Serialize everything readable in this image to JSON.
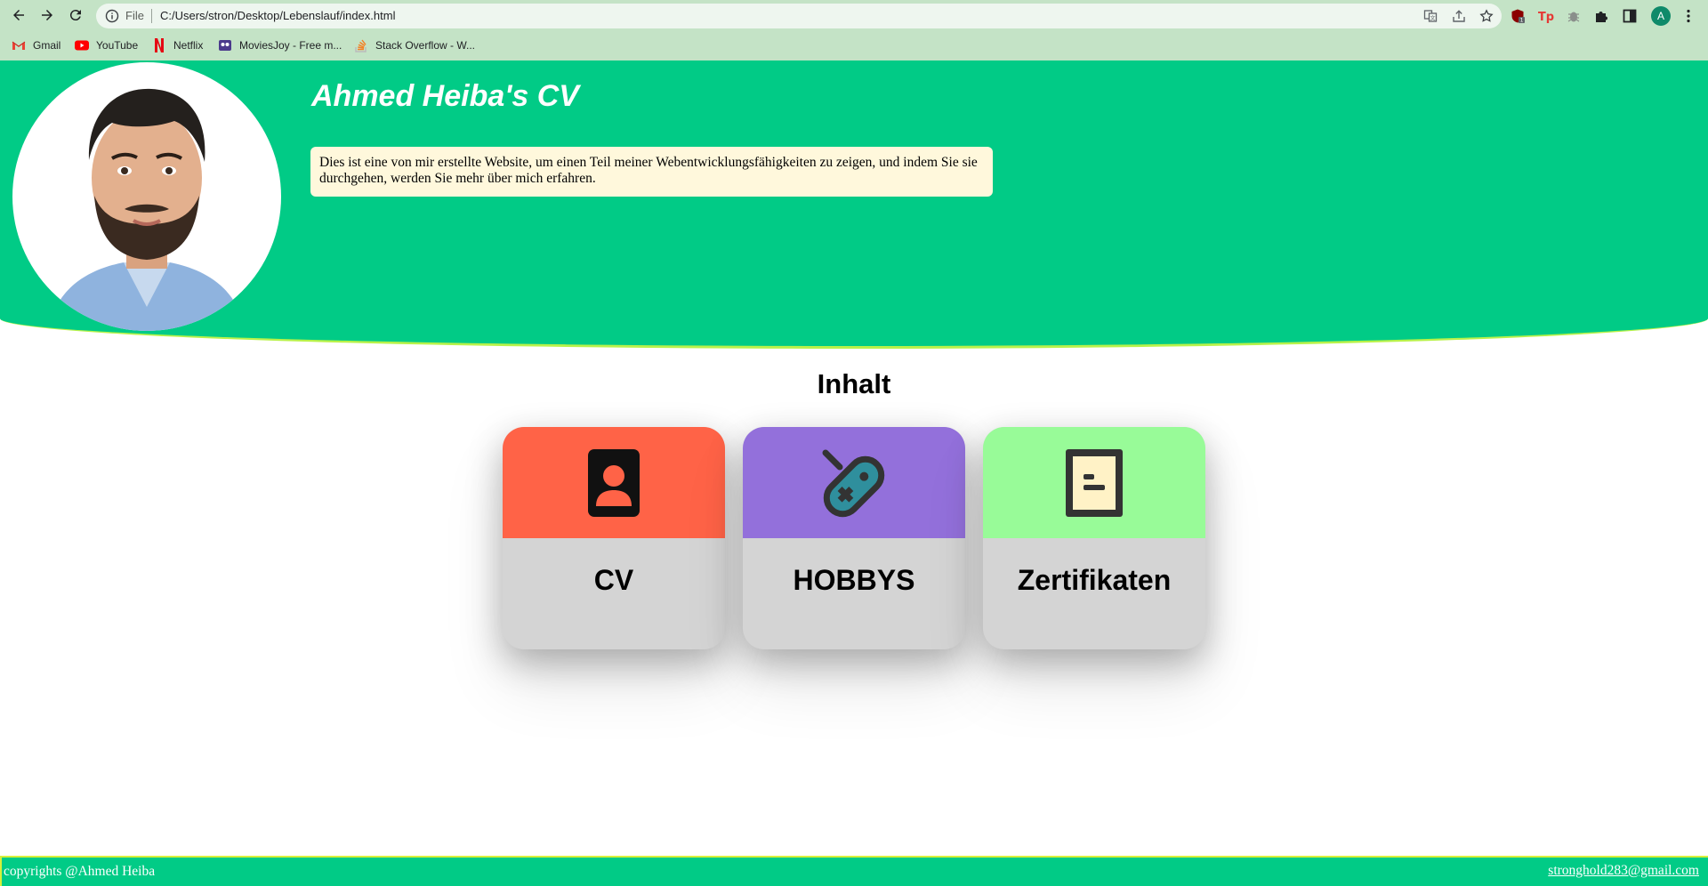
{
  "browser": {
    "omnibox": {
      "scheme_label": "File",
      "url": "C:/Users/stron/Desktop/Lebenslauf/index.html"
    },
    "profile_initial": "A",
    "bookmarks": [
      {
        "label": "Gmail",
        "icon": "gmail-icon"
      },
      {
        "label": "YouTube",
        "icon": "youtube-icon"
      },
      {
        "label": "Netflix",
        "icon": "netflix-icon"
      },
      {
        "label": "MoviesJoy - Free m...",
        "icon": "moviesjoy-icon"
      },
      {
        "label": "Stack Overflow - W...",
        "icon": "stackoverflow-icon"
      }
    ]
  },
  "page": {
    "title": "Ahmed Heiba's CV",
    "intro": "Dies ist eine von mir erstellte Website, um einen Teil meiner Webentwicklungsfähigkeiten zu zeigen, und indem Sie sie durchgehen, werden Sie mehr über mich erfahren.",
    "section_title": "Inhalt",
    "cards": [
      {
        "label": "CV",
        "icon": "contact-card-icon",
        "color": "#ff6347"
      },
      {
        "label": "HOBBYS",
        "icon": "gamepad-icon",
        "color": "#9370db"
      },
      {
        "label": "Zertifikaten",
        "icon": "document-icon",
        "color": "#98fb98"
      }
    ],
    "footer": {
      "copyright": "copyrights @Ahmed Heiba",
      "email": "stronghold283@gmail.com"
    },
    "colors": {
      "hero": "#01cb86",
      "intro_bg": "#fff8dc",
      "card_bottom": "#d4d4d4"
    }
  }
}
